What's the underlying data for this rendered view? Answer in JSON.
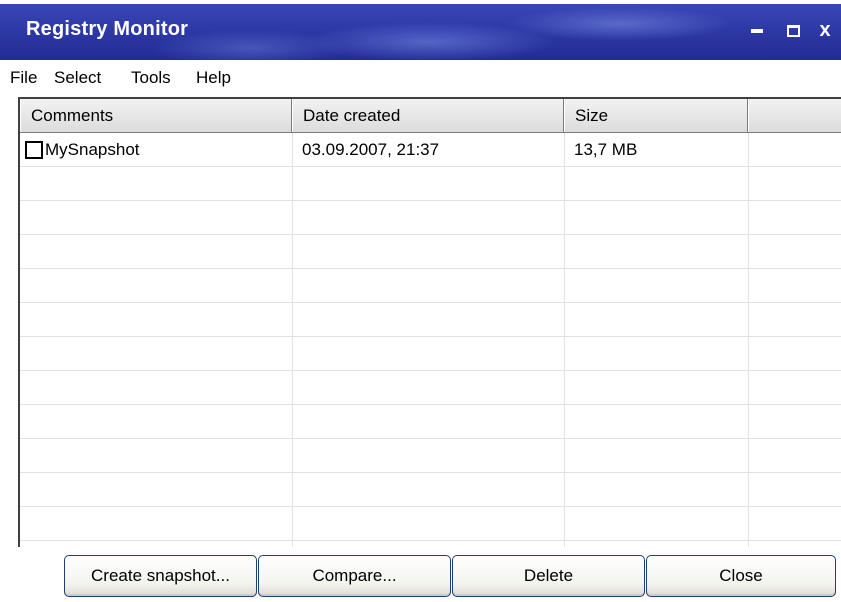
{
  "window": {
    "title": "Registry Monitor",
    "accent_color": "#2e39a8"
  },
  "caption_buttons": {
    "minimize_icon": "minimize-icon",
    "maximize_icon": "maximize-icon",
    "close_label": "x"
  },
  "menu": {
    "items": [
      {
        "label": "File"
      },
      {
        "label": "Select"
      },
      {
        "label": "Tools"
      },
      {
        "label": "Help"
      }
    ]
  },
  "table": {
    "columns": [
      {
        "label": "Comments"
      },
      {
        "label": "Date created"
      },
      {
        "label": "Size"
      },
      {
        "label": ""
      }
    ],
    "rows": [
      {
        "checked": false,
        "comment": "MySnapshot",
        "date": "03.09.2007, 21:37",
        "size": "13,7 MB"
      }
    ]
  },
  "buttons": {
    "create": "Create snapshot...",
    "compare": "Compare...",
    "delete": "Delete",
    "close": "Close"
  }
}
